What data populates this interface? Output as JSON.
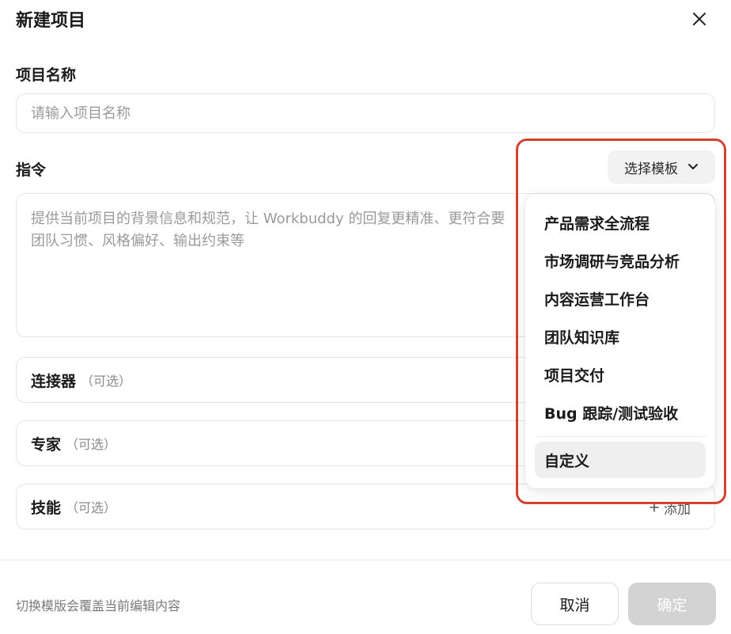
{
  "dialog": {
    "title": "新建项目",
    "close_icon": "close-icon"
  },
  "project_name": {
    "label": "项目名称",
    "placeholder": "请输入项目名称",
    "value": ""
  },
  "instruction": {
    "label": "指令",
    "template_button": "选择模板",
    "placeholder_line1": "提供当前项目的背景信息和规范，让 Workbuddy 的回复更精准、更符合要",
    "placeholder_line2": "团队习惯、风格偏好、输出约束等"
  },
  "options": [
    {
      "title": "连接器",
      "sub": "（可选）"
    },
    {
      "title": "专家",
      "sub": "（可选）"
    },
    {
      "title": "技能",
      "sub": "（可选）",
      "add": "添加",
      "add_icon": "plus-icon"
    }
  ],
  "template_menu": {
    "items": [
      "产品需求全流程",
      "市场调研与竞品分析",
      "内容运营工作台",
      "团队知识库",
      "项目交付",
      "Bug 跟踪/测试验收"
    ],
    "custom": "自定义"
  },
  "footer": {
    "hint": "切换模版会覆盖当前编辑内容",
    "cancel": "取消",
    "confirm": "确定"
  },
  "colors": {
    "highlight": "#d2432f",
    "confirm_disabled": "#d3d3d3"
  }
}
